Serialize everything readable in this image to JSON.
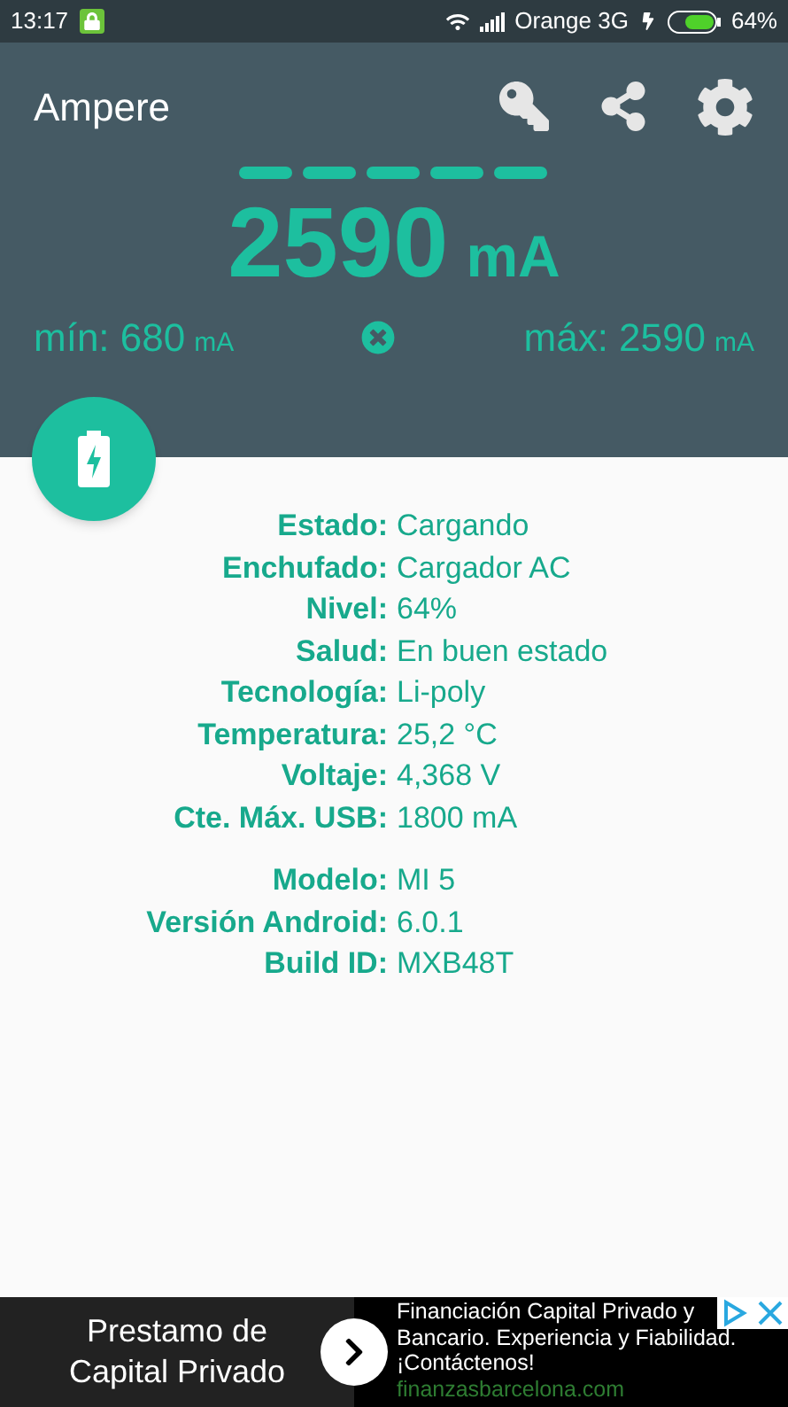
{
  "status_bar": {
    "time": "13:17",
    "carrier": "Orange 3G",
    "battery": "64%"
  },
  "app_bar": {
    "title": "Ampere"
  },
  "current": {
    "value": "2590",
    "unit": "mA"
  },
  "min": {
    "label": "mín: 680",
    "unit": "mA"
  },
  "max": {
    "label": "máx: 2590",
    "unit": "mA"
  },
  "info_groups": [
    [
      {
        "label": "Estado:",
        "value": "Cargando"
      },
      {
        "label": "Enchufado:",
        "value": "Cargador AC"
      },
      {
        "label": "Nivel:",
        "value": "64%"
      },
      {
        "label": "Salud:",
        "value": "En buen estado"
      },
      {
        "label": "Tecnología:",
        "value": "Li-poly"
      },
      {
        "label": "Temperatura:",
        "value": "25,2 °C"
      },
      {
        "label": "Voltaje:",
        "value": "4,368 V"
      },
      {
        "label": "Cte. Máx. USB:",
        "value": "1800 mA"
      }
    ],
    [
      {
        "label": "Modelo:",
        "value": "MI 5"
      },
      {
        "label": "Versión Android:",
        "value": "6.0.1"
      },
      {
        "label": "Build ID:",
        "value": "MXB48T"
      }
    ]
  ],
  "ad": {
    "headline": "Prestamo de Capital Privado",
    "lines": [
      "Financiación Capital Privado y",
      "Bancario. Experiencia y Fiabilidad.",
      "¡Contáctenos!"
    ],
    "url": "finanzasbarcelona.com"
  }
}
